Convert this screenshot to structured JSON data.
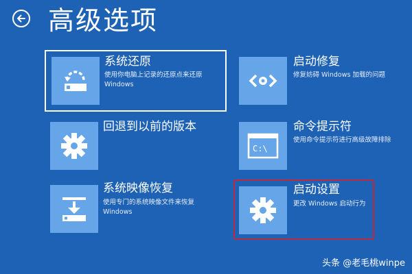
{
  "page": {
    "title": "高级选项"
  },
  "options": {
    "system_restore": {
      "title": "系统还原",
      "desc_line1": "使用你电脑上记录的还原点来还原",
      "desc_line2": "Windows",
      "icon": "system-restore-icon"
    },
    "startup_repair": {
      "title": "启动修复",
      "desc_line1": "修复妨碍 Windows 加载的问题",
      "icon": "code-brackets-icon"
    },
    "go_back": {
      "title": "回退到以前的版本",
      "icon": "gear-icon"
    },
    "command_prompt": {
      "title": "命令提示符",
      "desc_line1": "使用命令提示符进行高级故障排除",
      "icon": "command-prompt-icon",
      "icon_text": "C:\\"
    },
    "image_recovery": {
      "title": "系统映像恢复",
      "desc_line1": "使用专门的系统映像文件来恢复",
      "desc_line2": "Windows",
      "icon": "image-recovery-icon"
    },
    "startup_settings": {
      "title": "启动设置",
      "desc_line1": "更改 Windows 启动行为",
      "icon": "gear-icon"
    }
  },
  "watermark": {
    "text": "头条 @老毛桃winpe"
  },
  "colors": {
    "background": "#1e62b5",
    "tile_icon": "#66a6e8",
    "highlight_border": "#c0283c"
  }
}
